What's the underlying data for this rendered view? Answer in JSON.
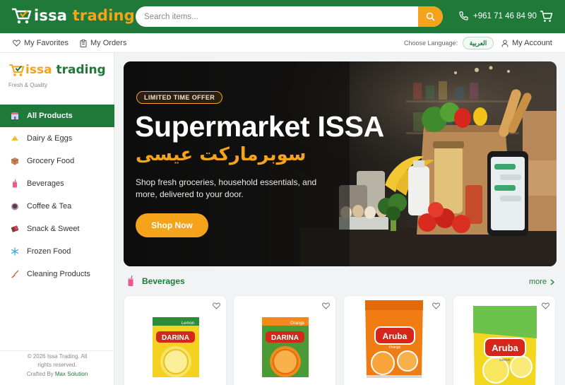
{
  "header": {
    "brand_main": "issa",
    "brand_accent": "trading",
    "search_placeholder": "Search items...",
    "phone": "+961 71 46 84 90"
  },
  "subbar": {
    "favorites": "My Favorites",
    "orders": "My Orders",
    "language_label": "Choose Language:",
    "language_value": "العربية",
    "account": "My Account"
  },
  "sidebar": {
    "brand_main": "issa",
    "brand_accent": "trading",
    "tagline": "Fresh & Quality",
    "items": [
      {
        "label": "All Products",
        "icon": "store-icon"
      },
      {
        "label": "Dairy & Eggs",
        "icon": "cheese-icon"
      },
      {
        "label": "Grocery Food",
        "icon": "box-icon"
      },
      {
        "label": "Beverages",
        "icon": "drink-icon"
      },
      {
        "label": "Coffee & Tea",
        "icon": "coffee-icon"
      },
      {
        "label": "Snack & Sweet",
        "icon": "chocolate-icon"
      },
      {
        "label": "Frozen Food",
        "icon": "snowflake-icon"
      },
      {
        "label": "Cleaning Products",
        "icon": "broom-icon"
      }
    ],
    "footer_copy": "© 2026 Issa Trading. All rights reserved.",
    "footer_crafted": "Crafted By",
    "footer_maker": "Max Solution"
  },
  "hero": {
    "badge": "LIMITED TIME OFFER",
    "title": "Supermarket ISSA",
    "arabic": "سوبرماركت عيسى",
    "description": "Shop fresh groceries, household essentials, and more, delivered to your door.",
    "cta": "Shop Now"
  },
  "section": {
    "title": "Beverages",
    "more": "more"
  },
  "products": [
    {
      "brand": "DARINA",
      "flavor": "Lemon",
      "color": "#f4d320"
    },
    {
      "brand": "DARINA",
      "flavor": "Orange",
      "color": "#f08a1a"
    },
    {
      "brand": "Aruba",
      "flavor": "Orange",
      "color": "#f07c14"
    },
    {
      "brand": "Aruba",
      "flavor": "Lemon",
      "color": "#f3d71f"
    }
  ],
  "colors": {
    "brand_green": "#1f7a3a",
    "accent_orange": "#f5a31b"
  }
}
